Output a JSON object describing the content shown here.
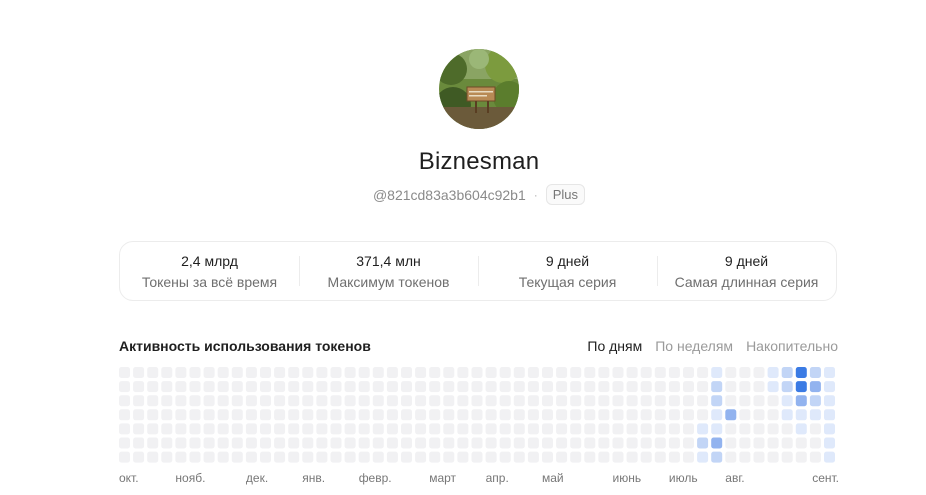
{
  "profile": {
    "name": "Biznesman",
    "handle": "@821cd83a3b604c92b1",
    "separator": "·",
    "plan": "Plus"
  },
  "stats": [
    {
      "value": "2,4 млрд",
      "label": "Токены за всё время"
    },
    {
      "value": "371,4 млн",
      "label": "Максимум токенов"
    },
    {
      "value": "9 дней",
      "label": "Текущая серия"
    },
    {
      "value": "9 дней",
      "label": "Самая длинная серия"
    }
  ],
  "activity": {
    "title": "Активность использования токенов",
    "tabs": [
      {
        "label": "По дням",
        "active": true
      },
      {
        "label": "По неделям",
        "active": false
      },
      {
        "label": "Накопительно",
        "active": false
      }
    ],
    "months": [
      "окт.",
      "нояб.",
      "дек.",
      "янв.",
      "февр.",
      "март",
      "апр.",
      "май",
      "июнь",
      "июль",
      "авг.",
      "сент."
    ],
    "month_start_weeks": [
      0,
      4,
      9,
      13,
      17,
      22,
      26,
      30,
      35,
      39,
      43,
      48
    ],
    "weeks": 51,
    "days": 7,
    "colors": {
      "level0": "#f1f1f3",
      "level1": "#dfe9fb",
      "level2": "#c2d5f6",
      "level3": "#92b3ef",
      "level4": "#3b7be4"
    },
    "levels": [
      [
        42,
        0,
        1
      ],
      [
        42,
        1,
        2
      ],
      [
        42,
        2,
        2
      ],
      [
        42,
        3,
        1
      ],
      [
        42,
        4,
        1
      ],
      [
        42,
        5,
        3
      ],
      [
        42,
        6,
        2
      ],
      [
        41,
        4,
        1
      ],
      [
        41,
        5,
        2
      ],
      [
        41,
        6,
        1
      ],
      [
        43,
        3,
        3
      ],
      [
        46,
        0,
        1
      ],
      [
        46,
        1,
        1
      ],
      [
        47,
        0,
        2
      ],
      [
        47,
        1,
        2
      ],
      [
        47,
        2,
        1
      ],
      [
        47,
        3,
        1
      ],
      [
        48,
        0,
        4
      ],
      [
        48,
        1,
        4
      ],
      [
        48,
        2,
        3
      ],
      [
        48,
        3,
        1
      ],
      [
        48,
        4,
        1
      ],
      [
        49,
        0,
        2
      ],
      [
        49,
        1,
        3
      ],
      [
        49,
        2,
        2
      ],
      [
        49,
        3,
        1
      ],
      [
        50,
        0,
        1
      ],
      [
        50,
        1,
        1
      ],
      [
        50,
        2,
        1
      ],
      [
        50,
        3,
        1
      ],
      [
        50,
        4,
        1
      ],
      [
        50,
        5,
        1
      ],
      [
        50,
        6,
        1
      ]
    ]
  }
}
